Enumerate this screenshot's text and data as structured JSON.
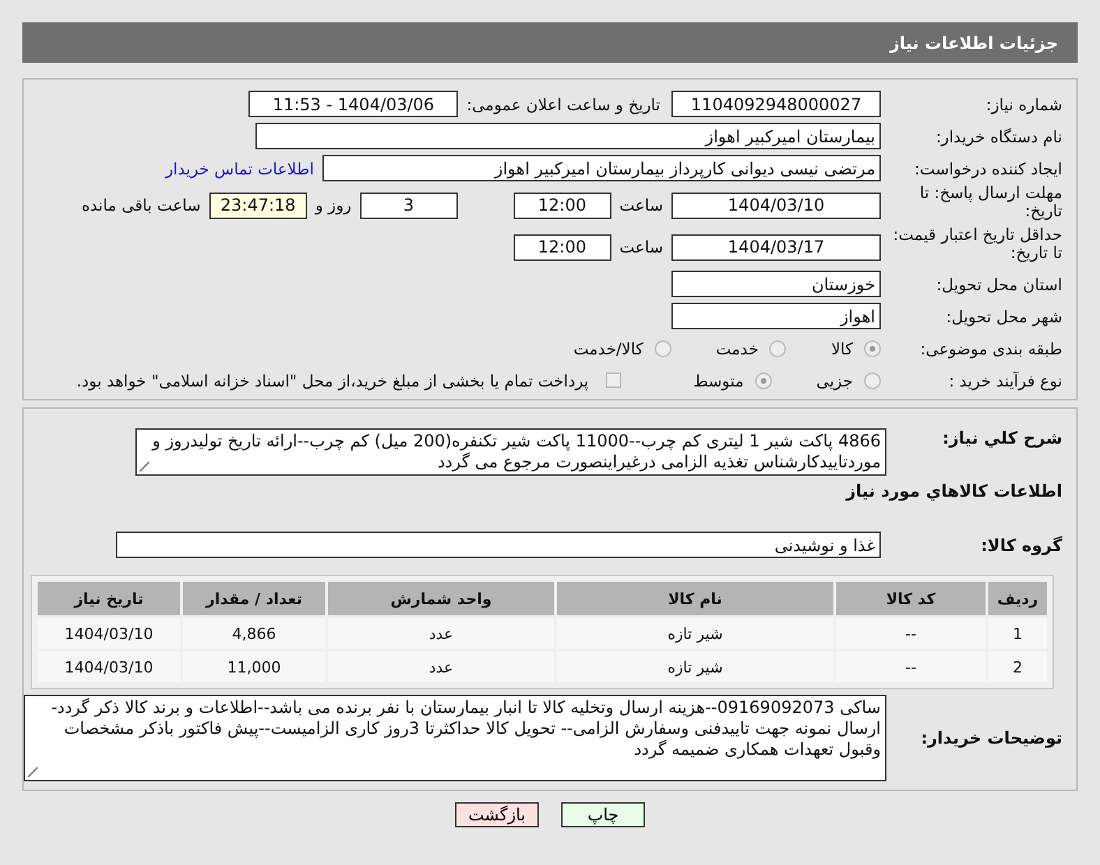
{
  "header": {
    "title": "جزئیات اطلاعات نیاز"
  },
  "need_number": {
    "label": "شماره نیاز:",
    "value": "1104092948000027"
  },
  "announce": {
    "label": "تاریخ و ساعت اعلان عمومی:",
    "value": "1404/03/06 - 11:53"
  },
  "buyer": {
    "label": "نام دستگاه خریدار:",
    "value": "بیمارستان امیرکبیر اهواز"
  },
  "creator": {
    "label": "ایجاد کننده درخواست:",
    "value": "مرتضی نیسی دیوانی کارپرداز بیمارستان امیرکبیر اهواز",
    "link": "اطلاعات تماس خریدار"
  },
  "deadline": {
    "label": "مهلت ارسال پاسخ: تا تاریخ:",
    "date": "1404/03/10",
    "time_label": "ساعت",
    "time": "12:00",
    "days": "3",
    "days_label": "روز و",
    "remaining": "23:47:18",
    "remaining_label": "ساعت باقی مانده"
  },
  "validity": {
    "label": "حداقل تاریخ اعتبار قیمت: تا تاریخ:",
    "date": "1404/03/17",
    "time_label": "ساعت",
    "time": "12:00"
  },
  "province": {
    "label": "استان محل تحویل:",
    "value": "خوزستان"
  },
  "city": {
    "label": "شهر محل تحویل:",
    "value": "اهواز"
  },
  "category": {
    "label": "طبقه بندی موضوعی:",
    "options": [
      {
        "label": "کالا",
        "selected": true
      },
      {
        "label": "خدمت",
        "selected": false
      },
      {
        "label": "کالا/خدمت",
        "selected": false
      }
    ]
  },
  "process": {
    "label": "نوع فرآیند خرید :",
    "options": [
      {
        "label": "جزیی",
        "selected": false
      },
      {
        "label": "متوسط",
        "selected": true
      }
    ],
    "treasury": {
      "checked": false,
      "text": "پرداخت تمام یا بخشی از مبلغ خرید،از محل \"اسناد خزانه اسلامی\" خواهد بود."
    }
  },
  "summary": {
    "label": "شرح کلي نياز:",
    "value": "4866 پاکت شیر 1 لیتری کم چرب--11000 پاکت شیر تکنفره(200 میل) کم چرب--ارائه تاریخ تولیدروز و موردتاییدکارشناس تغذیه الزامی درغیراینصورت مرجوع می گردد"
  },
  "goods_heading": "اطلاعات کالاهاي مورد نياز",
  "goods_group": {
    "label": "گروه کالا:",
    "value": "غذا و نوشیدنی"
  },
  "table": {
    "columns": [
      "ردیف",
      "کد کالا",
      "نام کالا",
      "واحد شمارش",
      "تعداد / مقدار",
      "تاریخ نیاز"
    ],
    "rows": [
      [
        "1",
        "--",
        "شیر تازه",
        "عدد",
        "4,866",
        "1404/03/10"
      ],
      [
        "2",
        "--",
        "شیر تازه",
        "عدد",
        "11,000",
        "1404/03/10"
      ]
    ]
  },
  "notes": {
    "label": "توضیحات خریدار:",
    "value": "ساکی 09169092073--هزینه ارسال وتخلیه کالا تا انبار بیمارستان با نفر برنده می باشد--اطلاعات و برند کالا ذکر گردد-ارسال نمونه جهت تاییدفنی وسفارش الزامی-- تحویل کالا حداکثرتا 3روز کاری الزامیست--پیش فاکتور باذکر مشخصات وقبول تعهدات همکاری ضمیمه گردد"
  },
  "buttons": [
    {
      "label": "چاپ",
      "kind": "print"
    },
    {
      "label": "بازگشت",
      "kind": "back"
    }
  ]
}
